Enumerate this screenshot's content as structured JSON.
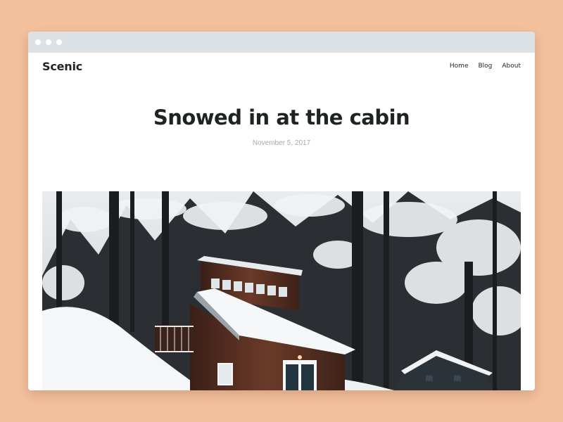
{
  "site": {
    "logo": "Scenic"
  },
  "nav": {
    "items": [
      {
        "label": "Home"
      },
      {
        "label": "Blog"
      },
      {
        "label": "About"
      }
    ]
  },
  "post": {
    "title": "Snowed in at the cabin",
    "date": "November 5, 2017"
  },
  "colors": {
    "page_background": "#f4c19f",
    "titlebar": "#dce1e5",
    "text_primary": "#1f2323",
    "text_muted": "#a3a9ae"
  }
}
